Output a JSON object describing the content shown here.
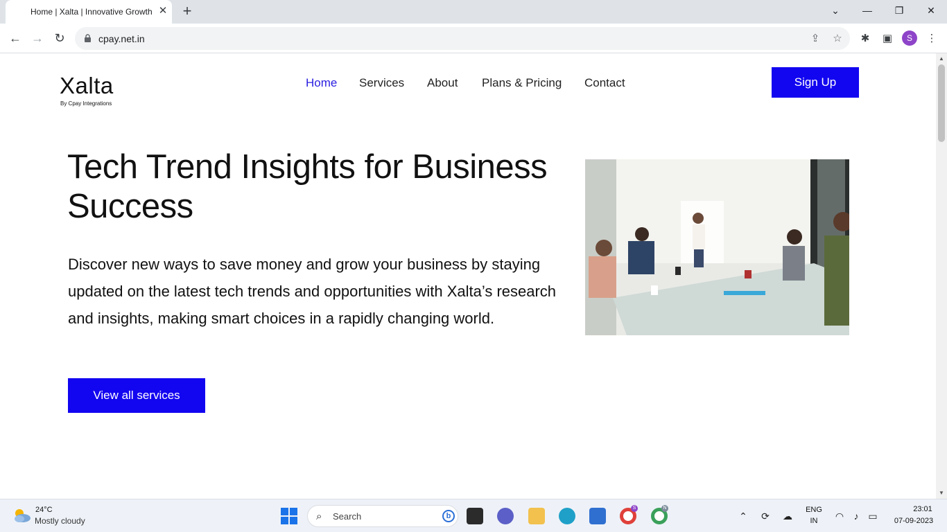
{
  "browser": {
    "tab_title": "Home | Xalta | Innovative Growth",
    "url": "cpay.net.in",
    "profile_initial": "S"
  },
  "site": {
    "logo": "Xalta",
    "logo_sub": "By Cpay Integrations",
    "nav": [
      {
        "label": "Home",
        "active": true
      },
      {
        "label": "Services",
        "active": false
      },
      {
        "label": "About",
        "active": false
      },
      {
        "label": "Plans & Pricing",
        "active": false
      },
      {
        "label": "Contact",
        "active": false
      }
    ],
    "signup_label": "Sign Up",
    "hero": {
      "headline": "Tech Trend Insights for Business Success",
      "paragraph": "Discover new ways to save money and grow your business by staying updated on the latest tech trends and opportunities with Xalta’s research and insights, making smart choices in a rapidly changing world.",
      "cta_label": "View all services"
    },
    "accent_color": "#1205f0"
  },
  "taskbar": {
    "weather_temp": "24°C",
    "weather_desc": "Mostly cloudy",
    "search_placeholder": "Search",
    "language_1": "ENG",
    "language_2": "IN",
    "time": "23:01",
    "date": "07-09-2023",
    "chrome_profile_1": "S",
    "chrome_profile_2": "N"
  }
}
